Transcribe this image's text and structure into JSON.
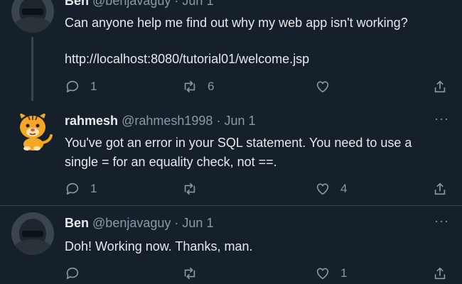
{
  "tweets": [
    {
      "name": "Ben",
      "handle": "@benjavaguy",
      "separator": "·",
      "date": "Jun 1",
      "text_lines": [
        "Can anyone help me find out why my web app isn't working?"
      ],
      "link": "http://localhost:8080/tutorial01/welcome.jsp",
      "replies": "1",
      "retweets": "6",
      "likes": "",
      "avatar": "helmet-avatar"
    },
    {
      "name": "rahmesh",
      "handle": "@rahmesh1998",
      "separator": "·",
      "date": "Jun 1",
      "more": "···",
      "text_lines": [
        "You've got an error in your SQL statement. You need to use a",
        "single = for an equality check, not ==."
      ],
      "replies": "1",
      "retweets": "",
      "likes": "4",
      "avatar": "tiger-emoji-avatar"
    },
    {
      "name": "Ben",
      "handle": "@benjavaguy",
      "separator": "·",
      "date": "Jun 1",
      "more": "···",
      "text_lines": [
        "Doh! Working now. Thanks, man."
      ],
      "replies": "",
      "retweets": "",
      "likes": "1",
      "avatar": "helmet-avatar"
    }
  ],
  "icons": [
    "reply-icon",
    "retweet-icon",
    "like-icon",
    "share-icon",
    "more-icon"
  ],
  "colors": {
    "background": "#15202b",
    "text": "#e7e9ea",
    "muted": "#8b98a5",
    "line": "#38444d"
  }
}
